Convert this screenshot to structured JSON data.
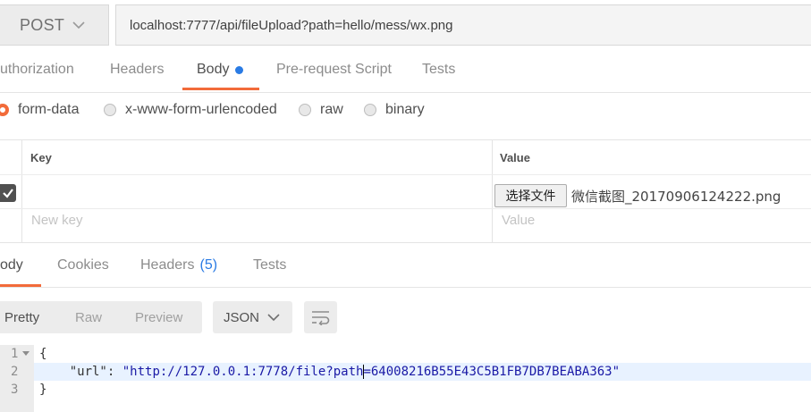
{
  "request": {
    "method": "POST",
    "url": "localhost:7777/api/fileUpload?path=hello/mess/wx.png"
  },
  "request_tabs": {
    "authorization": "uthorization",
    "headers": "Headers",
    "body": "Body",
    "pre_request": "Pre-request Script",
    "tests": "Tests",
    "body_indicator_color": "#2a7be4"
  },
  "body_types": {
    "form_data": "form-data",
    "urlencoded": "x-www-form-urlencoded",
    "raw": "raw",
    "binary": "binary",
    "selected": "form-data"
  },
  "form_table": {
    "key_header": "Key",
    "value_header": "Value",
    "rows": [
      {
        "checked": true,
        "key": "",
        "file_button": "选择文件",
        "file_name": "微信截图_20170906124222.png"
      }
    ],
    "new_key_placeholder": "New key",
    "new_value_placeholder": "Value"
  },
  "response_tabs": {
    "body": "ody",
    "cookies": "Cookies",
    "headers": "Headers",
    "headers_count": "(5)",
    "tests": "Tests"
  },
  "view": {
    "pretty": "Pretty",
    "raw": "Raw",
    "preview": "Preview",
    "format": "JSON"
  },
  "code": {
    "line_numbers": [
      "1",
      "2",
      "3"
    ],
    "open_brace": "{",
    "key": "\"url\"",
    "colon": ": ",
    "value_before_cursor": "\"http://127.0.0.1:7778/file?path",
    "value_after_cursor": "=64008216B55E43C5B1FB7DB7BEABA363\"",
    "close_brace": "}"
  },
  "colors": {
    "accent": "#f26b3a",
    "link_blue": "#2a7be4",
    "json_string": "#1a1aa6"
  }
}
